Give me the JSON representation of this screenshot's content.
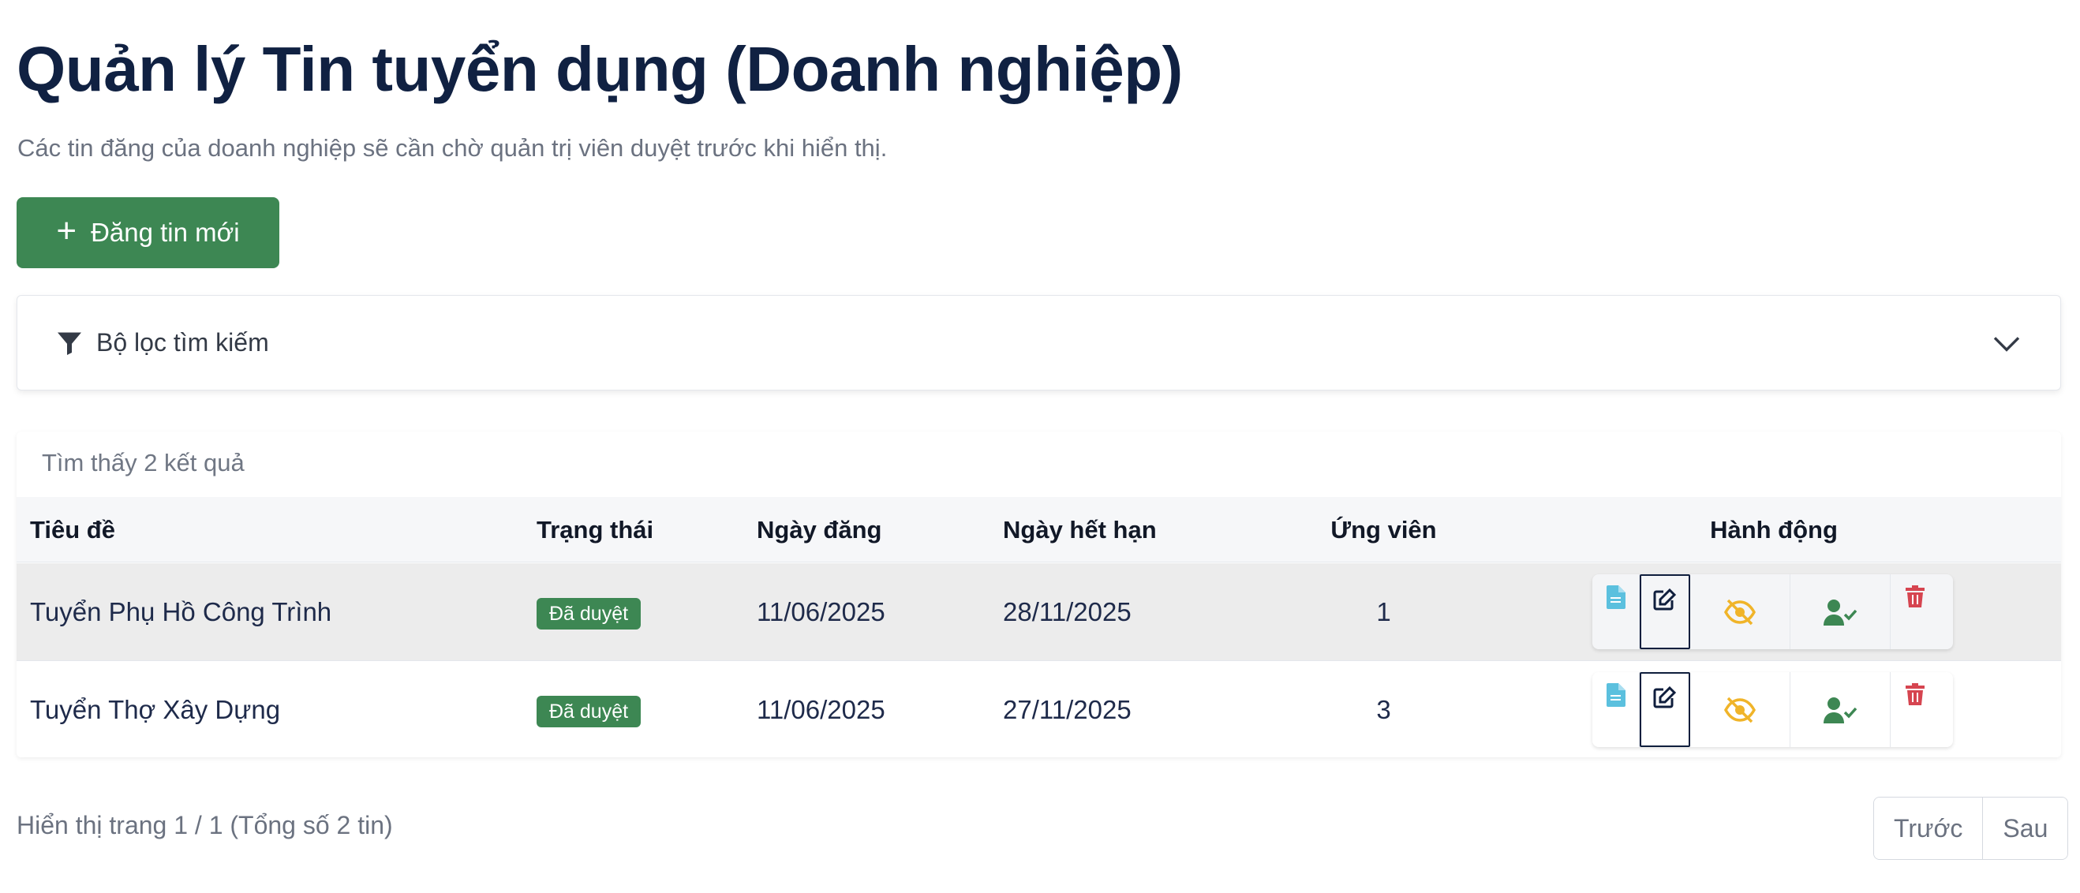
{
  "header": {
    "title": "Quản lý Tin tuyển dụng (Doanh nghiệp)",
    "subtitle": "Các tin đăng của doanh nghiệp sẽ cần chờ quản trị viên duyệt trước khi hiển thị."
  },
  "toolbar": {
    "new_post_label": "Đăng tin mới",
    "new_post_icon": "plus-icon"
  },
  "filter": {
    "label": "Bộ lọc tìm kiếm",
    "icon": "funnel-icon",
    "toggle_icon": "chevron-down-icon"
  },
  "results": {
    "count_text": "Tìm thấy 2 kết quả"
  },
  "table": {
    "columns": [
      "Tiêu đề",
      "Trạng thái",
      "Ngày đăng",
      "Ngày hết hạn",
      "Ứng viên",
      "Hành động"
    ],
    "rows": [
      {
        "title": "Tuyển Phụ Hồ Công Trình",
        "status": "Đã duyệt",
        "posted": "11/06/2025",
        "expires": "28/11/2025",
        "candidates": "1"
      },
      {
        "title": "Tuyển Thợ Xây Dựng",
        "status": "Đã duyệt",
        "posted": "11/06/2025",
        "expires": "27/11/2025",
        "candidates": "3"
      }
    ],
    "action_icons": [
      "document-icon",
      "edit-icon",
      "eye-slash-icon",
      "user-check-icon",
      "trash-icon"
    ]
  },
  "pagination": {
    "info": "Hiển thị trang 1 / 1 (Tổng số 2 tin)",
    "prev_label": "Trước",
    "next_label": "Sau"
  },
  "colors": {
    "title": "#102142",
    "primary_green": "#3d8753",
    "doc_icon": "#5bc0de",
    "hide_icon": "#f0b429",
    "delete_icon": "#d64550",
    "selected_row": "#ececec"
  }
}
